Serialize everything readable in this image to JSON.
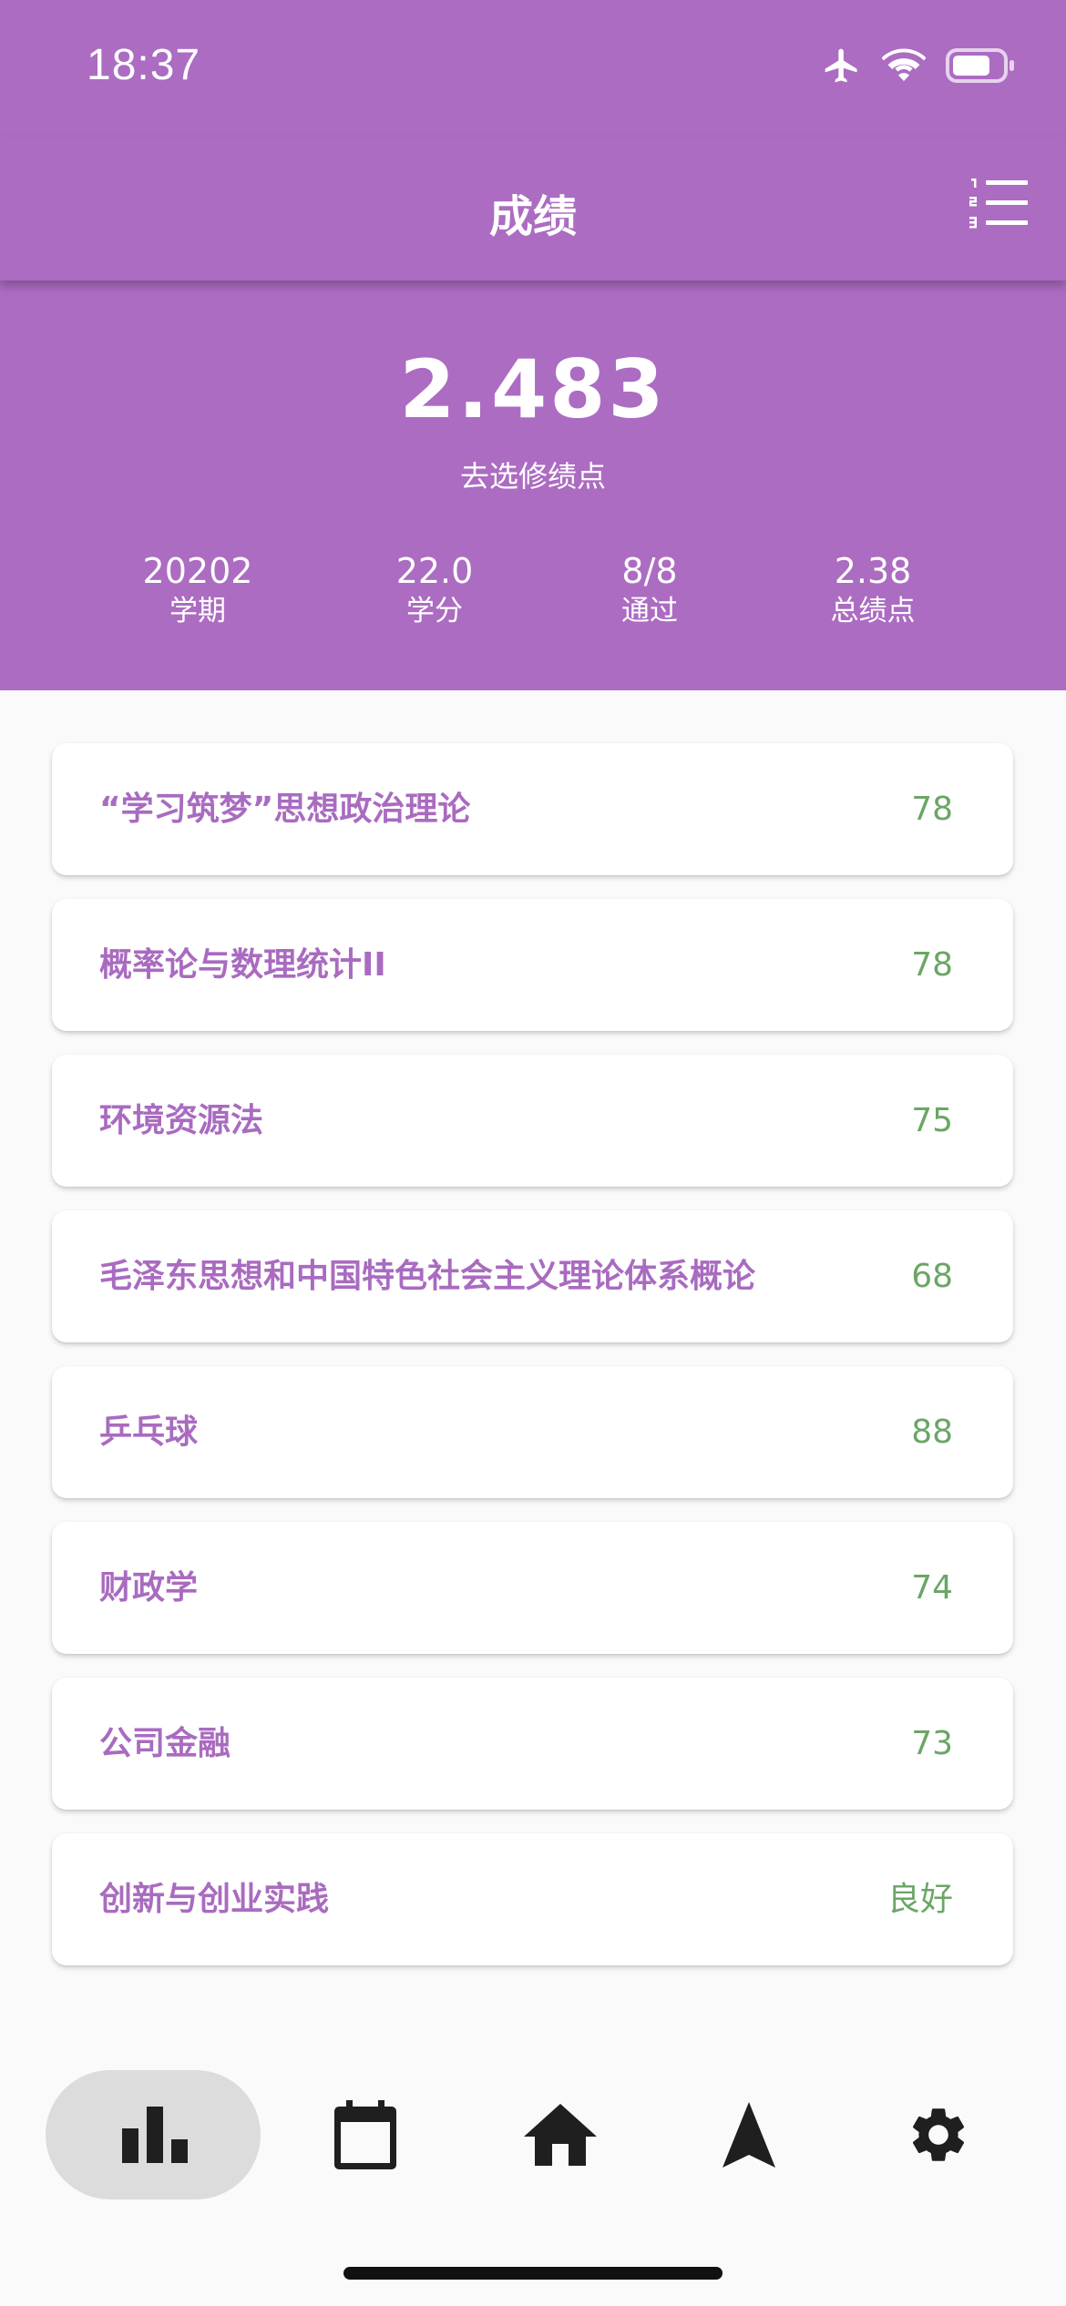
{
  "status_bar": {
    "time": "18:37",
    "icons": [
      "airplane-icon",
      "wifi-icon",
      "battery-icon"
    ]
  },
  "app_bar": {
    "title": "成绩",
    "sort_icon": "sort-list-icon"
  },
  "summary": {
    "gpa": "2.483",
    "gpa_label": "去选修绩点",
    "stats": [
      {
        "value": "20202",
        "label": "学期"
      },
      {
        "value": "22.0",
        "label": "学分"
      },
      {
        "value": "8/8",
        "label": "通过"
      },
      {
        "value": "2.38",
        "label": "总绩点"
      }
    ]
  },
  "courses": [
    {
      "name": "“学习筑梦”思想政治理论",
      "score": "78"
    },
    {
      "name": "概率论与数理统计II",
      "score": "78"
    },
    {
      "name": "环境资源法",
      "score": "75"
    },
    {
      "name": "毛泽东思想和中国特色社会主义理论体系概论",
      "score": "68"
    },
    {
      "name": "乒乓球",
      "score": "88"
    },
    {
      "name": "财政学",
      "score": "74"
    },
    {
      "name": "公司金融",
      "score": "73"
    },
    {
      "name": "创新与创业实践",
      "score": "良好"
    }
  ],
  "bottom_nav": {
    "active": "grades",
    "items": [
      {
        "id": "grades",
        "icon": "bar-chart-icon"
      },
      {
        "id": "schedule",
        "icon": "calendar-icon"
      },
      {
        "id": "home",
        "icon": "home-icon"
      },
      {
        "id": "navigation",
        "icon": "navigation-arrow-icon"
      },
      {
        "id": "settings",
        "icon": "gear-icon"
      }
    ]
  },
  "colors": {
    "primary": "#ac6cc2",
    "course_text": "#a96bc0",
    "score_text": "#6aa665",
    "background": "#fafafa"
  }
}
